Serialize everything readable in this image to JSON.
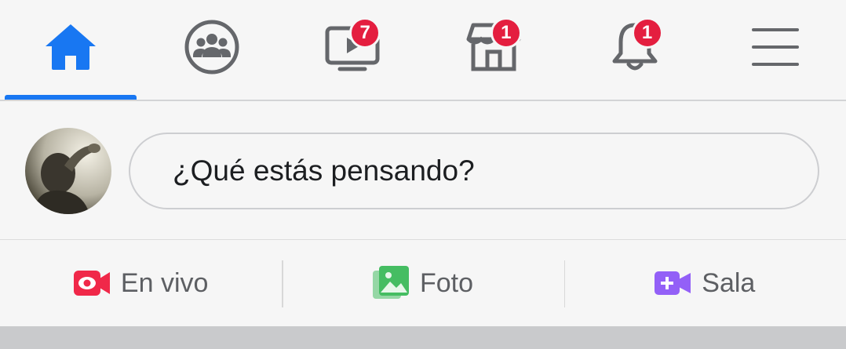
{
  "nav": {
    "tabs": [
      {
        "name": "home",
        "icon": "home-icon",
        "active": true,
        "badge": ""
      },
      {
        "name": "groups",
        "icon": "groups-icon",
        "active": false,
        "badge": ""
      },
      {
        "name": "watch",
        "icon": "video-icon",
        "active": false,
        "badge": "7"
      },
      {
        "name": "marketplace",
        "icon": "store-icon",
        "active": false,
        "badge": "1"
      },
      {
        "name": "notifications",
        "icon": "bell-icon",
        "active": false,
        "badge": "1"
      },
      {
        "name": "menu",
        "icon": "menu-icon",
        "active": false,
        "badge": ""
      }
    ]
  },
  "composer": {
    "placeholder": "¿Qué estás pensando?"
  },
  "actions": [
    {
      "label": "En vivo",
      "icon": "live-video-icon",
      "color": "#f02849"
    },
    {
      "label": "Foto",
      "icon": "photo-icon",
      "color": "#45bd62"
    },
    {
      "label": "Sala",
      "icon": "room-icon",
      "color": "#9360f7"
    }
  ],
  "colors": {
    "accent": "#1877f2",
    "badge": "#e41e3f",
    "icon_gray": "#65676b"
  }
}
